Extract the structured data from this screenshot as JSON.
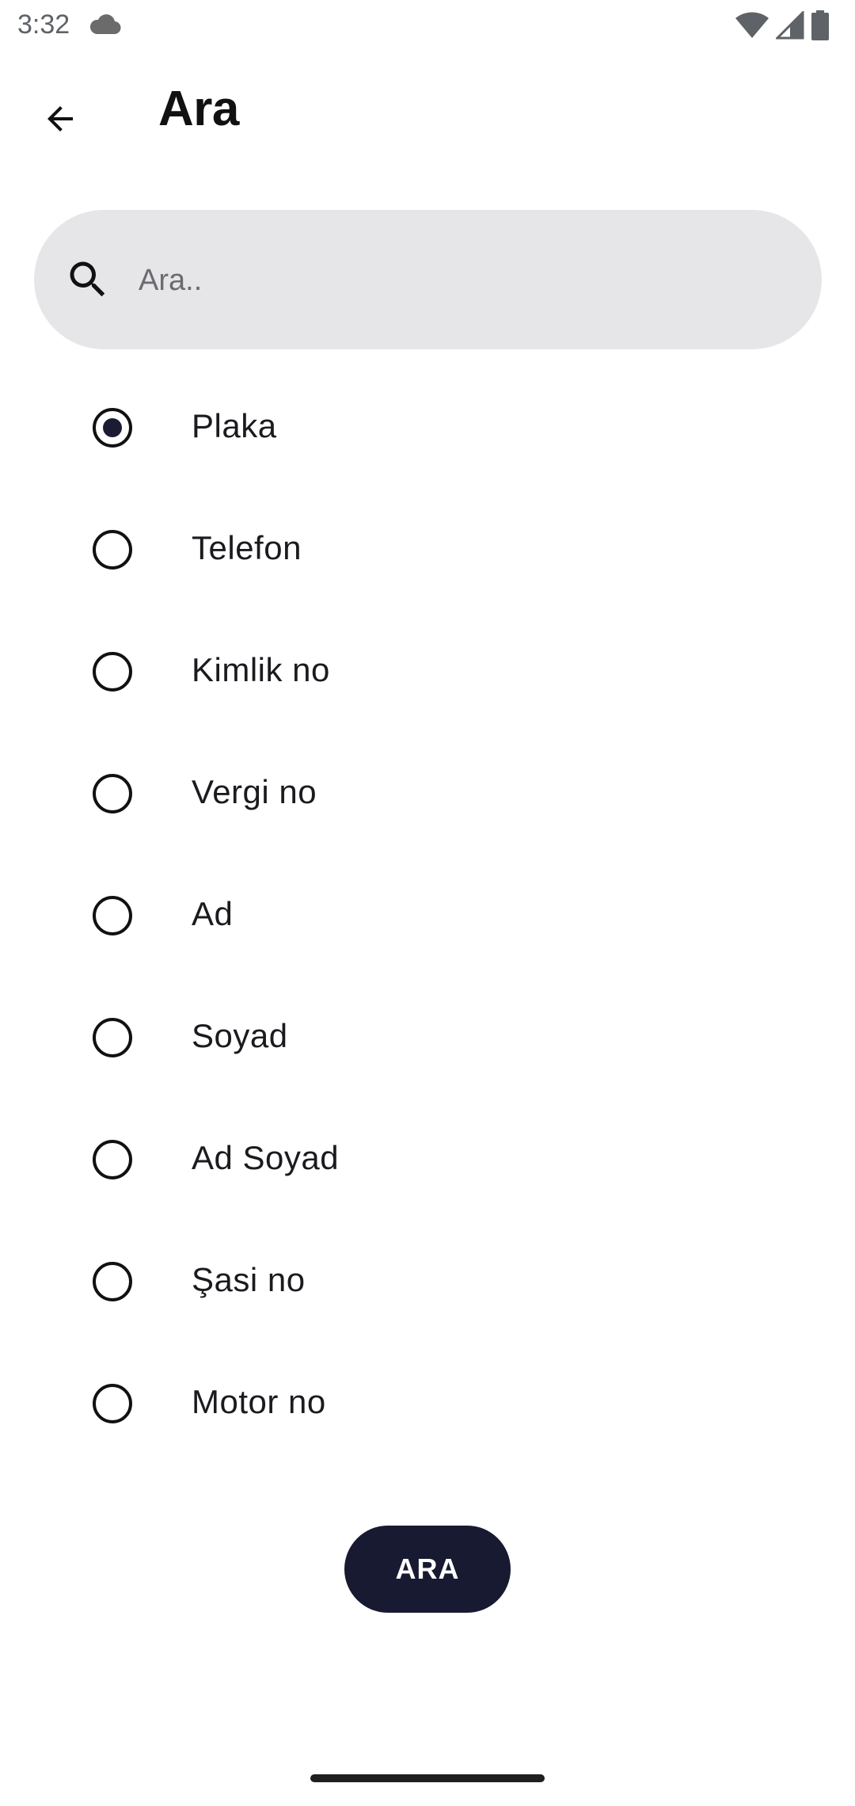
{
  "status_bar": {
    "time": "3:32",
    "icons": [
      "cloud-icon",
      "wifi-icon",
      "cell-signal-icon",
      "battery-icon"
    ]
  },
  "app_bar": {
    "title": "Ara",
    "back_icon": "arrow-back-icon"
  },
  "search": {
    "placeholder": "Ara..",
    "value": "",
    "icon": "search-icon"
  },
  "options": [
    {
      "label": "Plaka",
      "selected": true
    },
    {
      "label": "Telefon",
      "selected": false
    },
    {
      "label": "Kimlik no",
      "selected": false
    },
    {
      "label": "Vergi no",
      "selected": false
    },
    {
      "label": "Ad",
      "selected": false
    },
    {
      "label": "Soyad",
      "selected": false
    },
    {
      "label": "Ad Soyad",
      "selected": false
    },
    {
      "label": "Şasi no",
      "selected": false
    },
    {
      "label": "Motor no",
      "selected": false
    }
  ],
  "submit": {
    "label": "ARA"
  },
  "colors": {
    "search_background": "#e6e6e8",
    "button_background": "#171a30",
    "radio_selected": "#1b1c33"
  }
}
